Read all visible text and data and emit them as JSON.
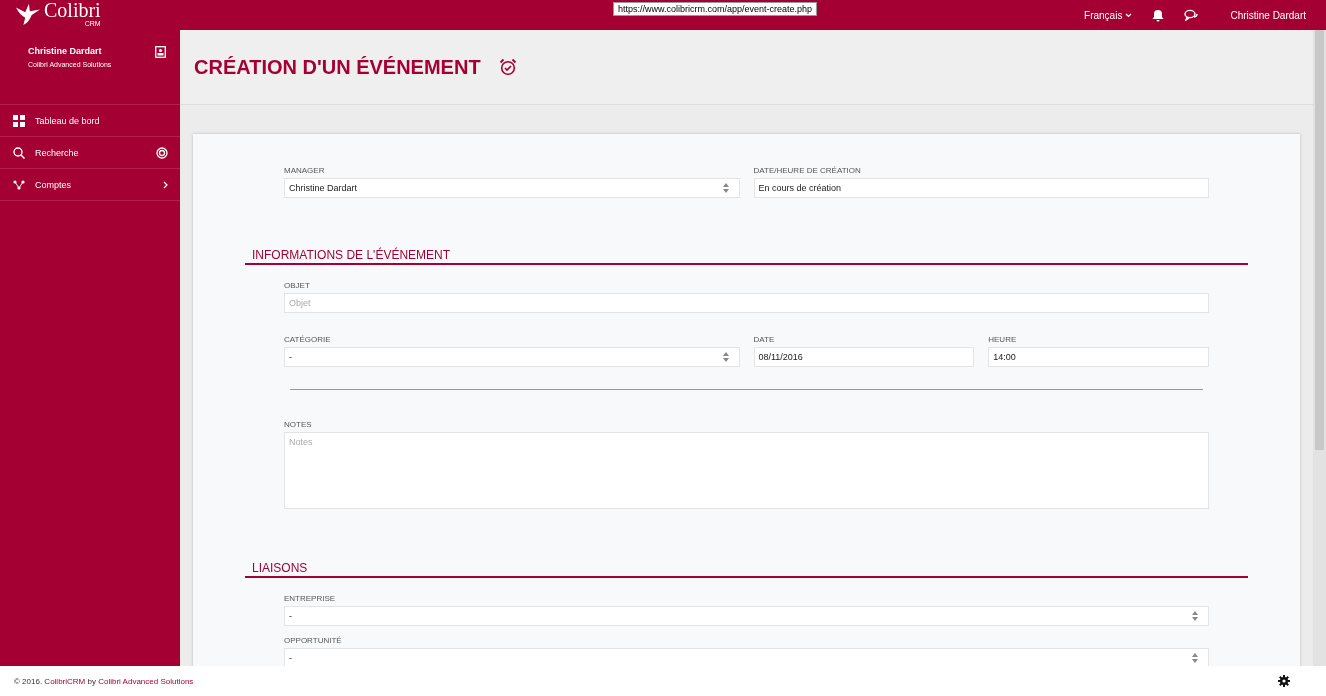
{
  "topbar": {
    "logo": {
      "name": "Colibri",
      "sub": "CRM"
    },
    "url_tooltip": "https://www.colibricrm.com/app/event-create.php",
    "language": "Français",
    "user": "Christine Dardart"
  },
  "sidebar": {
    "user": {
      "name": "Christine Dardart",
      "company": "Colibri Advanced Solutions"
    },
    "items": [
      {
        "label": "Tableau de bord",
        "kind": "dashboard",
        "has_submenu": false
      },
      {
        "label": "Recherche",
        "kind": "search",
        "has_submenu": false
      },
      {
        "label": "Comptes",
        "kind": "accounts",
        "has_submenu": true
      }
    ]
  },
  "page": {
    "title": "CRÉATION D'UN ÉVÉNEMENT"
  },
  "form": {
    "top_fields": [
      {
        "label": "MANAGER",
        "kind": "select",
        "value": "Christine Dardart"
      },
      {
        "label": "DATE/HEURE DE CRÉATION",
        "kind": "text",
        "value": "En cours de création"
      }
    ],
    "sections": [
      {
        "title": "INFORMATIONS DE L'ÉVÉNEMENT",
        "rows": [
          [
            {
              "label": "OBJET",
              "kind": "text",
              "placeholder": "Objet"
            }
          ],
          [
            {
              "label": "CATÉGORIE",
              "kind": "select",
              "value": "-"
            },
            {
              "label": "DATE",
              "kind": "text",
              "value": "08/11/2016"
            },
            {
              "label": "HEURE",
              "kind": "text",
              "value": "14:00"
            }
          ],
          [
            {
              "kind": "divider"
            }
          ],
          [
            {
              "label": "NOTES",
              "kind": "textarea",
              "placeholder": "Notes"
            }
          ]
        ]
      },
      {
        "title": "LIAISONS",
        "rows": [
          [
            {
              "label": "ENTREPRISE",
              "kind": "select",
              "value": "-"
            }
          ],
          [
            {
              "label": "OPPORTUNITÉ",
              "kind": "select",
              "value": "-"
            }
          ]
        ]
      }
    ]
  },
  "footer": {
    "prefix": "© 2016. ",
    "brand_link": "ColibriCRM",
    "middle": " by ",
    "company_link": "Colibri Advanced Solutions"
  }
}
